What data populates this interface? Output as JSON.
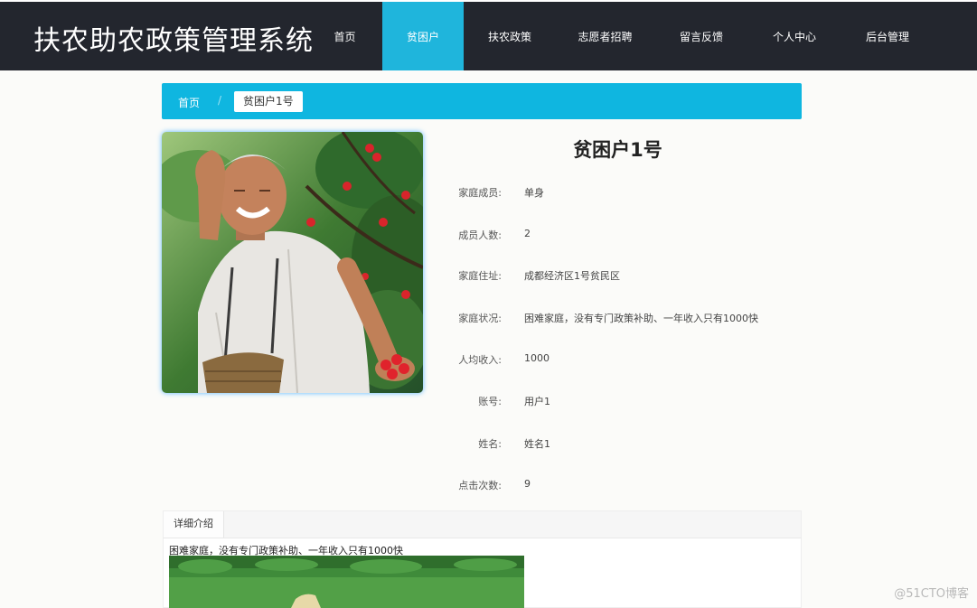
{
  "header": {
    "brand": "扶农助农政策管理系统",
    "nav": [
      {
        "label": "首页",
        "active": false
      },
      {
        "label": "贫困户",
        "active": true
      },
      {
        "label": "扶农政策",
        "active": false
      },
      {
        "label": "志愿者招聘",
        "active": false
      },
      {
        "label": "留言反馈",
        "active": false
      },
      {
        "label": "个人中心",
        "active": false
      },
      {
        "label": "后台管理",
        "active": false
      }
    ]
  },
  "breadcrumb": {
    "home": "首页",
    "separator": "/",
    "current": "贫困户1号"
  },
  "detail": {
    "title": "贫困户1号",
    "fields": [
      {
        "label": "家庭成员:",
        "value": "单身"
      },
      {
        "label": "成员人数:",
        "value": "2"
      },
      {
        "label": "家庭住址:",
        "value": "成都经济区1号贫民区"
      },
      {
        "label": "家庭状况:",
        "value": "困难家庭，没有专门政策补助、一年收入只有1000快"
      },
      {
        "label": "人均收入:",
        "value": "1000"
      },
      {
        "label": "账号:",
        "value": "用户1"
      },
      {
        "label": "姓名:",
        "value": "姓名1"
      },
      {
        "label": "点击次数:",
        "value": "9"
      }
    ]
  },
  "tabs": {
    "active": "详细介绍",
    "intro_text": "困难家庭，没有专门政策补助、一年收入只有1000快"
  },
  "watermark": "@51CTO博客",
  "colors": {
    "topbar": "#23262e",
    "nav_active": "#1fb5dc",
    "breadcrumb": "#0fb6e0"
  }
}
